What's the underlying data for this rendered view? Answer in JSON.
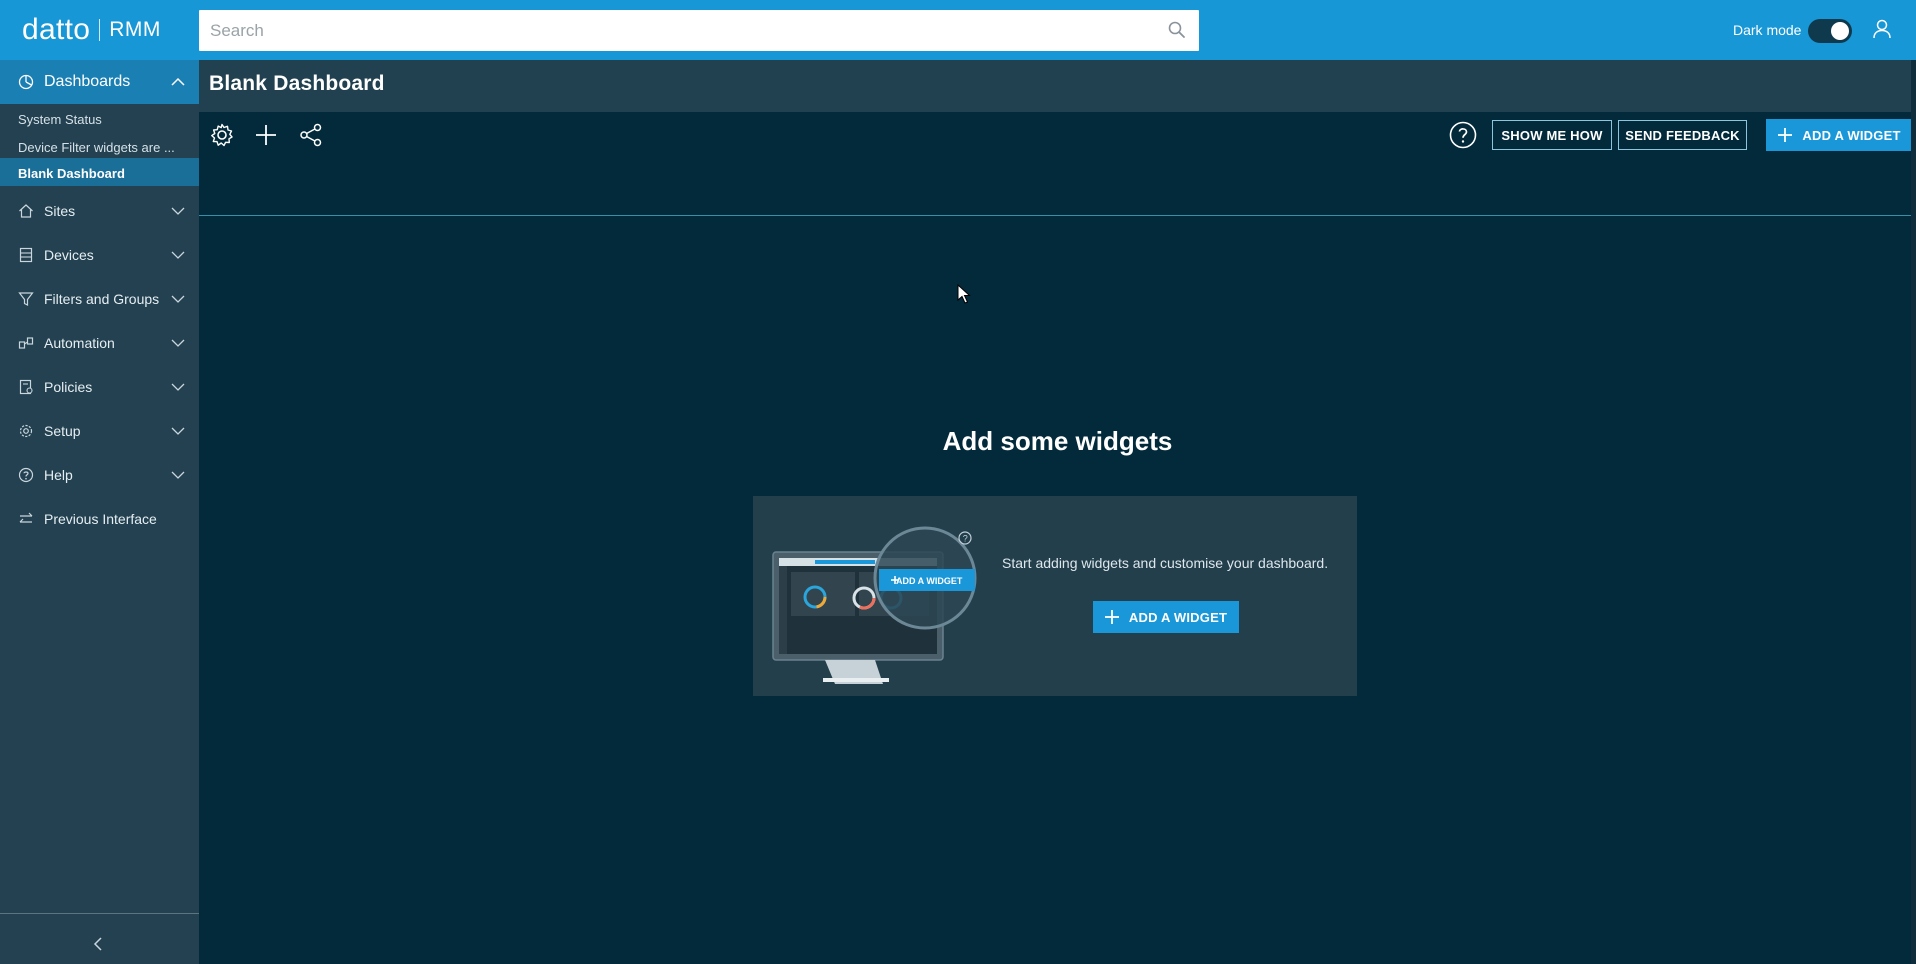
{
  "header": {
    "brand": "datto",
    "product": "RMM",
    "search_placeholder": "Search",
    "dark_mode_label": "Dark mode",
    "dark_mode_on": true
  },
  "sidebar": {
    "dashboards_label": "Dashboards",
    "dashboard_items": [
      "System Status",
      "Device Filter widgets are ...",
      "Blank Dashboard"
    ],
    "active_dashboard": "Blank Dashboard",
    "items": [
      {
        "label": "Sites",
        "icon": "home-icon"
      },
      {
        "label": "Devices",
        "icon": "devices-icon"
      },
      {
        "label": "Filters and Groups",
        "icon": "filter-icon"
      },
      {
        "label": "Automation",
        "icon": "automation-icon"
      },
      {
        "label": "Policies",
        "icon": "policies-icon"
      },
      {
        "label": "Setup",
        "icon": "gear-icon"
      },
      {
        "label": "Help",
        "icon": "help-icon"
      },
      {
        "label": "Previous Interface",
        "icon": "swap-icon"
      }
    ]
  },
  "main": {
    "page_title": "Blank Dashboard",
    "toolbar": {
      "show_me_how": "SHOW ME HOW",
      "send_feedback": "SEND FEEDBACK",
      "add_widget": "ADD A WIDGET"
    },
    "empty_state": {
      "title": "Add some widgets",
      "description": "Start adding widgets and customise your dashboard.",
      "button": "ADD A WIDGET",
      "illustration_button": "ADD A WIDGET"
    }
  },
  "colors": {
    "topbar": "#1897d6",
    "sidebar": "#234150",
    "main_bg": "#022a3b",
    "accent": "#1a97d9"
  }
}
